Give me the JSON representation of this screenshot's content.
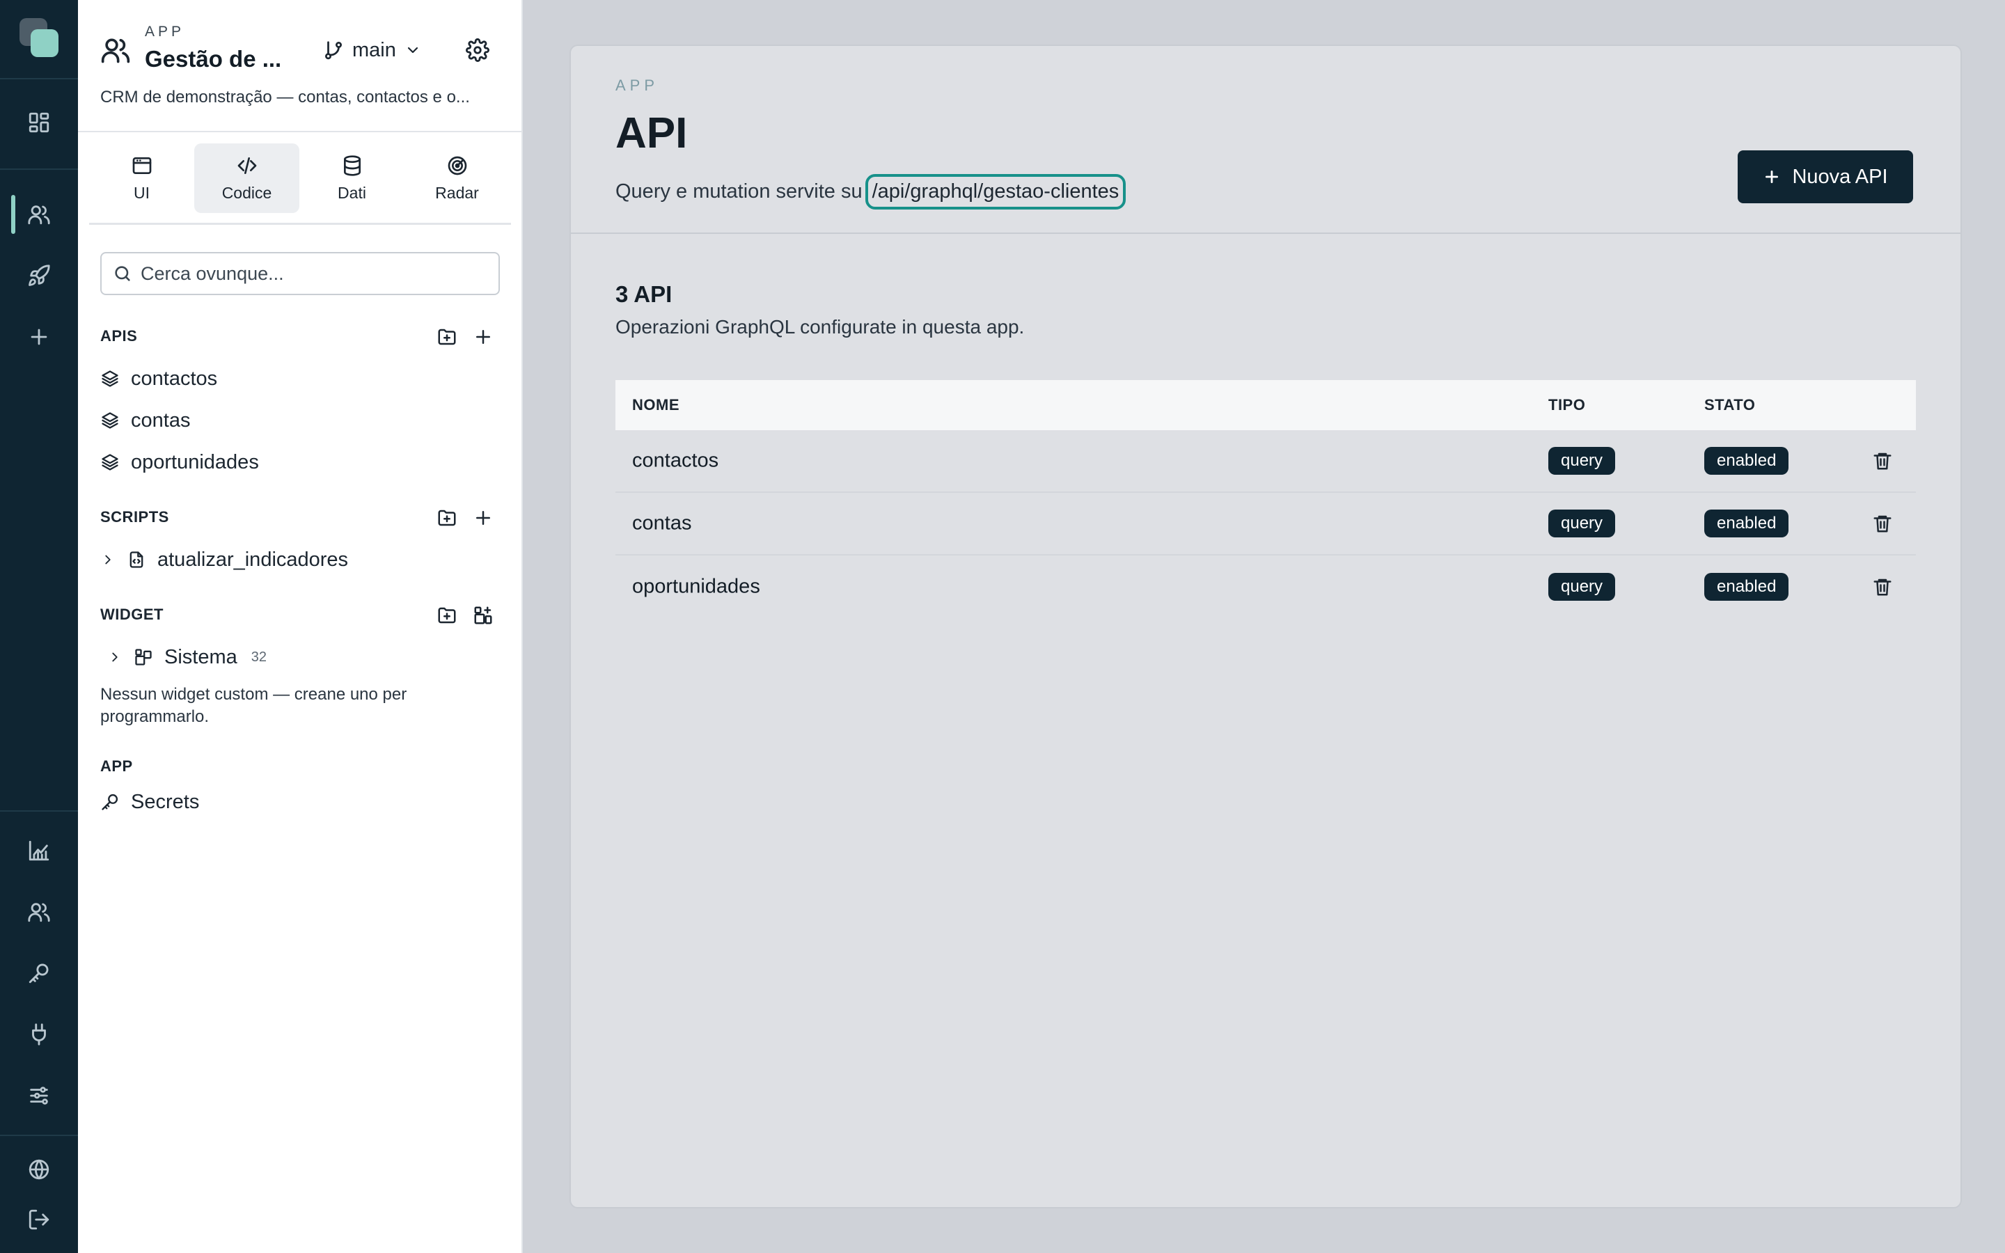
{
  "sidebar": {
    "kicker": "APP",
    "app_title": "Gestão de ...",
    "branch": "main",
    "description": "CRM de demonstração — contas, contactos e o...",
    "tabs": [
      {
        "label": "UI"
      },
      {
        "label": "Codice"
      },
      {
        "label": "Dati"
      },
      {
        "label": "Radar"
      }
    ],
    "search_placeholder": "Cerca ovunque...",
    "apis_label": "APIS",
    "apis": [
      "contactos",
      "contas",
      "oportunidades"
    ],
    "scripts_label": "SCRIPTS",
    "scripts": [
      "atualizar_indicadores"
    ],
    "widget_label": "WIDGET",
    "widget_group": {
      "label": "Sistema",
      "count": "32"
    },
    "widget_note": "Nessun widget custom — creane uno per programmarlo.",
    "app_label": "APP",
    "app_items": [
      "Secrets"
    ]
  },
  "main": {
    "kicker": "APP",
    "title": "API",
    "subtitle_prefix": "Query e mutation servite su",
    "endpoint": "/api/graphql/gestao-clientes",
    "new_button": "Nuova API",
    "count_title": "3 API",
    "count_desc": "Operazioni GraphQL configurate in questa app.",
    "table": {
      "headers": {
        "name": "NOME",
        "type": "TIPO",
        "state": "STATO"
      },
      "rows": [
        {
          "name": "contactos",
          "type": "query",
          "state": "enabled"
        },
        {
          "name": "contas",
          "type": "query",
          "state": "enabled"
        },
        {
          "name": "oportunidades",
          "type": "query",
          "state": "enabled"
        }
      ]
    }
  },
  "colors": {
    "rail_bg": "#0f2532",
    "accent": "#8fd1c5",
    "endpoint_outline": "#17918a",
    "pill_bg": "#0f2532"
  }
}
